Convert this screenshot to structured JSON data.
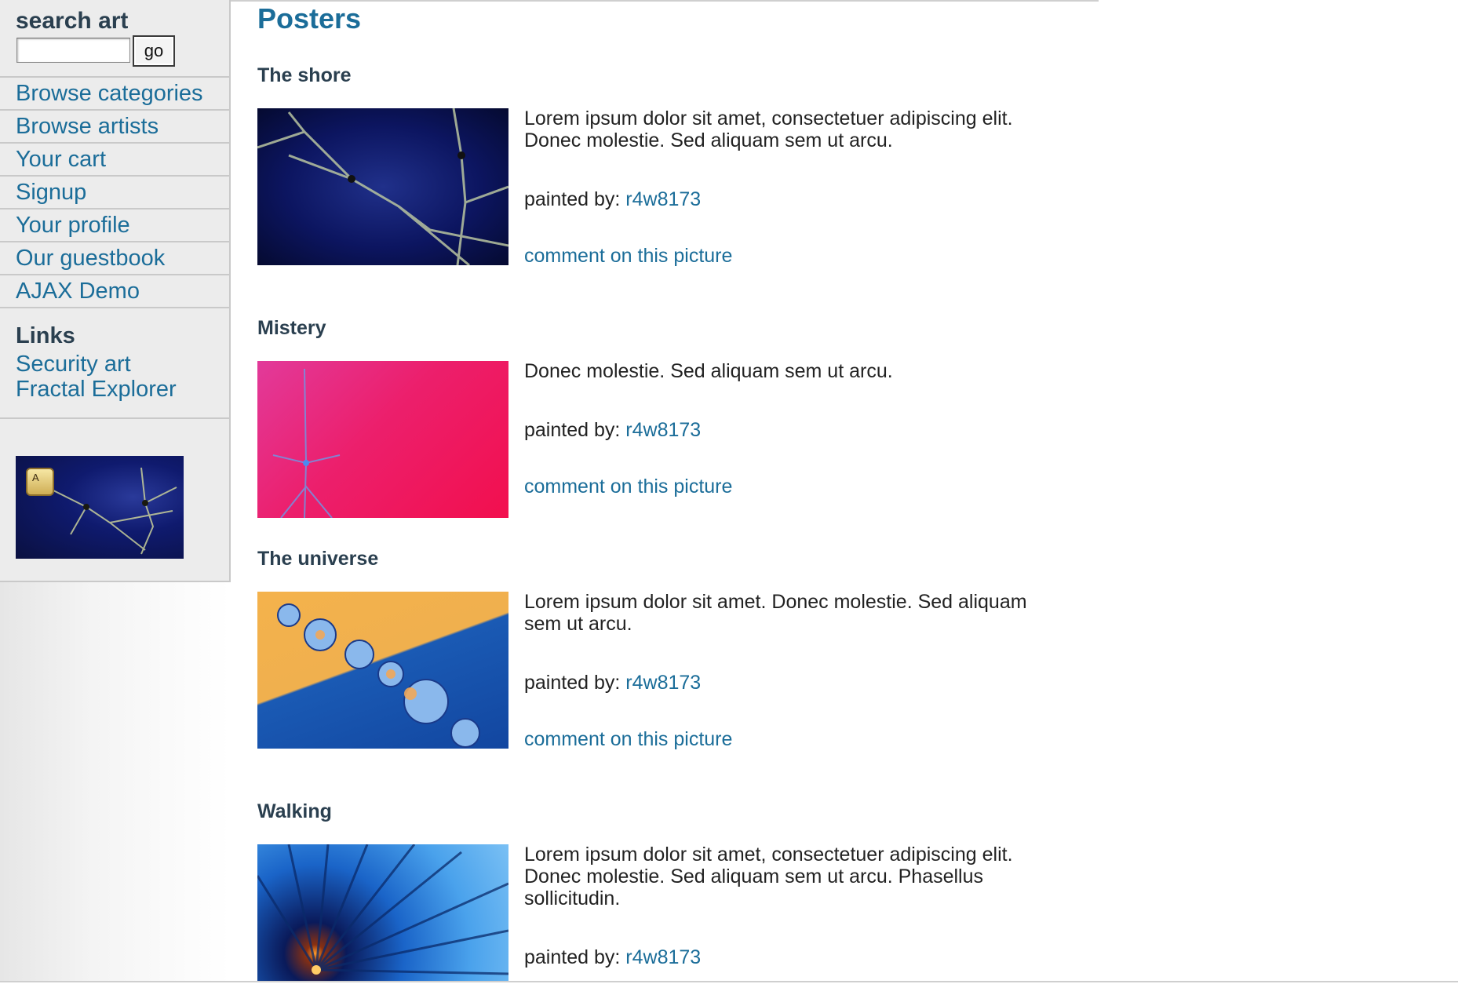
{
  "sidebar": {
    "search": {
      "label": "search art",
      "input_value": "",
      "button_label": "go"
    },
    "nav": [
      {
        "label": "Browse categories"
      },
      {
        "label": "Browse artists"
      },
      {
        "label": "Your cart"
      },
      {
        "label": "Signup"
      },
      {
        "label": "Your profile"
      },
      {
        "label": "Our guestbook"
      },
      {
        "label": "AJAX Demo"
      }
    ],
    "links": {
      "heading": "Links",
      "items": [
        {
          "label": "Security art"
        },
        {
          "label": "Fractal Explorer"
        }
      ]
    },
    "banner": {
      "key_label": "A"
    }
  },
  "main": {
    "title": "Posters",
    "pictures": [
      {
        "title": "The shore",
        "description": "Lorem ipsum dolor sit amet, consectetuer adipiscing elit. Donec molestie. Sed aliquam sem ut arcu.",
        "painted_by_label": "painted by:",
        "artist": "r4w8173",
        "comment_link": "comment on this picture"
      },
      {
        "title": "Mistery",
        "description": "Donec molestie. Sed aliquam sem ut arcu.",
        "painted_by_label": "painted by:",
        "artist": "r4w8173",
        "comment_link": "comment on this picture"
      },
      {
        "title": "The universe",
        "description": "Lorem ipsum dolor sit amet. Donec molestie. Sed aliquam sem ut arcu.",
        "painted_by_label": "painted by:",
        "artist": "r4w8173",
        "comment_link": "comment on this picture"
      },
      {
        "title": "Walking",
        "description": "Lorem ipsum dolor sit amet, consectetuer adipiscing elit. Donec molestie. Sed aliquam sem ut arcu. Phasellus sollicitudin.",
        "painted_by_label": "painted by:",
        "artist": "r4w8173"
      }
    ]
  }
}
